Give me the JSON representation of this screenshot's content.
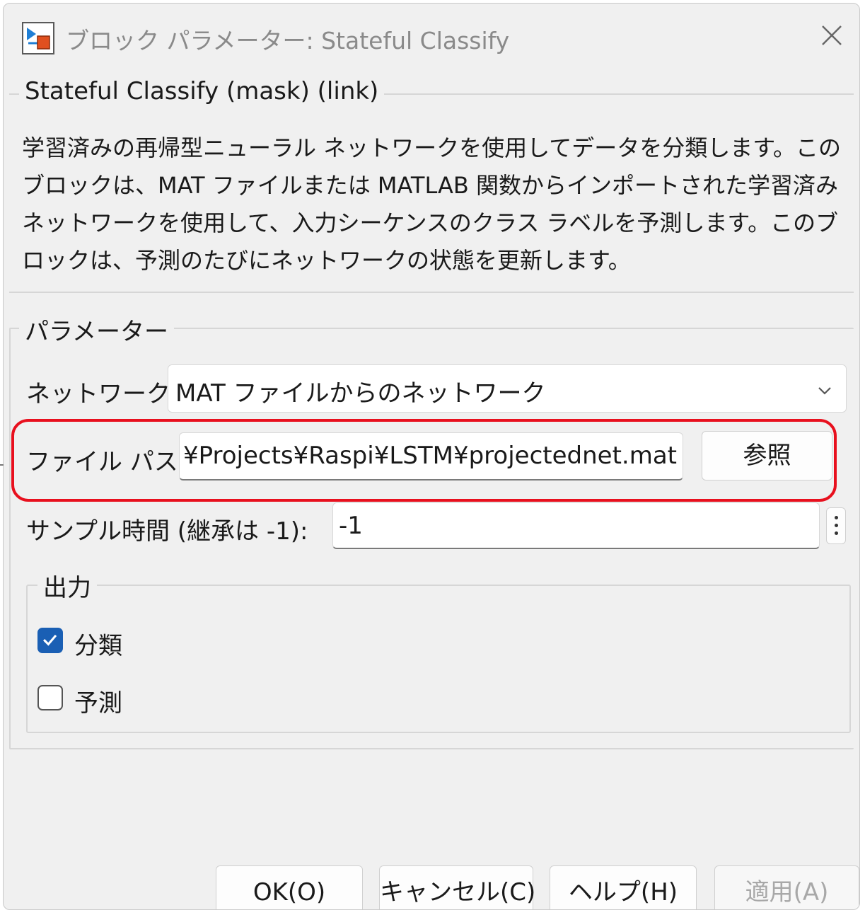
{
  "window": {
    "title": "ブロック パラメーター: Stateful Classify"
  },
  "description_group": {
    "title": "Stateful Classify (mask) (link)",
    "text": "学習済みの再帰型ニューラル ネットワークを使用してデータを分類します。この\nブロックは、MAT ファイルまたは MATLAB 関数からインポートされた学習済み\nネットワークを使用して、入力シーケンスのクラス ラベルを予測します。このブ\nロックは、予測のたびにネットワークの状態を更新します。"
  },
  "parameters": {
    "title": "パラメーター",
    "network_label": "ネットワーク:",
    "network_value": "MAT ファイルからのネットワーク",
    "file_path_label": "ファイル パス:",
    "file_path_value": "¥Projects¥Raspi¥LSTM¥projectednet.mat",
    "browse_label": "参照",
    "sample_time_label": "サンプル時間 (継承は -1):",
    "sample_time_value": "-1"
  },
  "output": {
    "title": "出力",
    "options": [
      {
        "label": "分類",
        "checked": true
      },
      {
        "label": "予測",
        "checked": false
      }
    ]
  },
  "buttons": {
    "ok": "OK(O)",
    "cancel": "キャンセル(C)",
    "help": "ヘルプ(H)",
    "apply": "適用(A)"
  },
  "colors": {
    "highlight": "#e8101e",
    "checkbox_accent": "#1a5fb4",
    "dialog_background": "#f0f0f0"
  },
  "icons": [
    "simulink-block-icon",
    "close-icon",
    "chevron-down-icon",
    "more-options-icon",
    "checkmark-icon"
  ]
}
